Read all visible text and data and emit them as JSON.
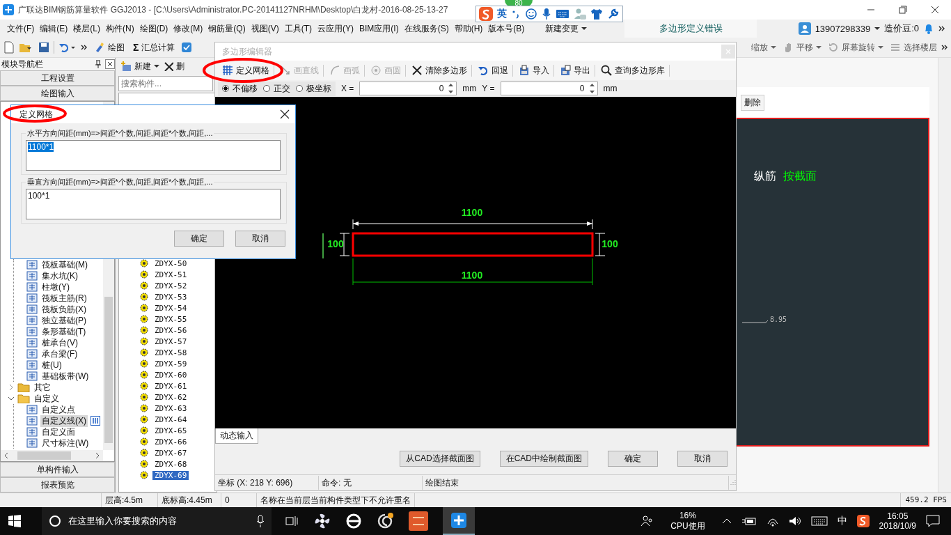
{
  "window": {
    "title": "广联达BIM钢筋算量软件 GGJ2013 - [C:\\Users\\Administrator.PC-20141127NRHM\\Desktop\\白龙村-2016-08-25-13-27"
  },
  "badge": "80",
  "ime_bar": {
    "label": "英"
  },
  "menu": [
    "文件(F)",
    "编辑(E)",
    "楼层(L)",
    "构件(N)",
    "绘图(D)",
    "修改(M)",
    "钢筋量(Q)",
    "视图(V)",
    "工具(T)",
    "云应用(Y)",
    "BIM应用(I)",
    "在线服务(S)",
    "帮助(H)",
    "版本号(B)"
  ],
  "menu_extra": {
    "new_change": "新建变更",
    "notice": "多边形定义错误",
    "account": "13907298339",
    "beans": "造价豆:0"
  },
  "toolbar": {
    "left": [
      {
        "kind": "draw",
        "label": "绘图"
      },
      {
        "kind": "sum",
        "symbol": "Σ",
        "label": "汇总计算"
      }
    ],
    "right": [
      {
        "kind": "zoom",
        "label": "缩放",
        "dropdown": true
      },
      {
        "kind": "pan",
        "label": "平移",
        "dropdown": true
      },
      {
        "kind": "rotate",
        "label": "屏幕旋转",
        "dropdown": true
      },
      {
        "kind": "floor",
        "label": "选择楼层",
        "dropdown": false
      }
    ]
  },
  "nav": {
    "title": "模块导航栏",
    "top_buttons": [
      "工程设置",
      "绘图输入"
    ],
    "tree": [
      {
        "expanded": true,
        "children": [
          {
            "label": "筏板基础(M)",
            "selected": false
          },
          {
            "label": "集水坑(K)",
            "selected": false
          },
          {
            "label": "柱墩(Y)",
            "selected": false
          },
          {
            "label": "筏板主筋(R)",
            "selected": false
          },
          {
            "label": "筏板负筋(X)",
            "selected": false
          },
          {
            "label": "独立基础(P)",
            "selected": false
          },
          {
            "label": "条形基础(T)",
            "selected": false
          },
          {
            "label": "桩承台(V)",
            "selected": false
          },
          {
            "label": "承台梁(F)",
            "selected": false
          },
          {
            "label": "桩(U)",
            "selected": false
          },
          {
            "label": "基础板带(W)",
            "selected": false
          }
        ]
      },
      {
        "label": "其它",
        "expanded": false
      },
      {
        "label": "自定义",
        "expanded": true,
        "children": [
          {
            "label": "自定义点",
            "selected": false
          },
          {
            "label": "自定义线(X)",
            "selected": true
          },
          {
            "label": "自定义面",
            "selected": false
          },
          {
            "label": "尺寸标注(W)",
            "selected": false
          }
        ]
      }
    ],
    "bottom_buttons": [
      "单构件输入",
      "报表预览"
    ]
  },
  "components": {
    "new": "新建",
    "delete": "删",
    "search_placeholder": "搜索构件...",
    "items": [
      {
        "label": "ZDYX-50",
        "selected": false
      },
      {
        "label": "ZDYX-51",
        "selected": false
      },
      {
        "label": "ZDYX-52",
        "selected": false
      },
      {
        "label": "ZDYX-53",
        "selected": false
      },
      {
        "label": "ZDYX-54",
        "selected": false
      },
      {
        "label": "ZDYX-55",
        "selected": false
      },
      {
        "label": "ZDYX-56",
        "selected": false
      },
      {
        "label": "ZDYX-57",
        "selected": false
      },
      {
        "label": "ZDYX-58",
        "selected": false
      },
      {
        "label": "ZDYX-59",
        "selected": false
      },
      {
        "label": "ZDYX-60",
        "selected": false
      },
      {
        "label": "ZDYX-61",
        "selected": false
      },
      {
        "label": "ZDYX-62",
        "selected": false
      },
      {
        "label": "ZDYX-63",
        "selected": false
      },
      {
        "label": "ZDYX-64",
        "selected": false
      },
      {
        "label": "ZDYX-65",
        "selected": false
      },
      {
        "label": "ZDYX-66",
        "selected": false
      },
      {
        "label": "ZDYX-67",
        "selected": false
      },
      {
        "label": "ZDYX-68",
        "selected": false
      },
      {
        "label": "ZDYX-69",
        "selected": true
      }
    ]
  },
  "editor": {
    "title": "多边形编辑器",
    "tools": [
      {
        "kind": "grid",
        "label": "定义网格",
        "disabled": false
      },
      {
        "kind": "line",
        "label": "画直线",
        "disabled": true
      },
      {
        "kind": "arc",
        "label": "画弧",
        "disabled": true
      },
      {
        "kind": "circle",
        "label": "画圆",
        "disabled": true
      },
      {
        "kind": "clear",
        "label": "清除多边形",
        "disabled": false
      },
      {
        "kind": "undo",
        "label": "回退",
        "disabled": false
      },
      {
        "kind": "import",
        "label": "导入",
        "disabled": false
      },
      {
        "kind": "export",
        "label": "导出",
        "disabled": false
      },
      {
        "kind": "search",
        "label": "查询多边形库",
        "disabled": false
      }
    ],
    "snap": [
      {
        "label": "不偏移",
        "selected": true
      },
      {
        "label": "正交",
        "selected": false
      },
      {
        "label": "极坐标",
        "selected": false
      }
    ],
    "x": {
      "label": "X =",
      "value": "0",
      "unit": "mm"
    },
    "y": {
      "label": "Y =",
      "value": "0",
      "unit": "mm"
    },
    "canvas": {
      "top_dim": "1100",
      "bottom_dim": "1100",
      "left_dim": "100",
      "right_dim": "100"
    },
    "dynamic_input": "动态输入",
    "buttons": [
      "从CAD选择截面图",
      "在CAD中绘制截面图",
      "确定",
      "取消"
    ],
    "status": [
      "坐标 (X: 218 Y: 696)",
      "命令: 无",
      "绘图结束"
    ]
  },
  "grid_dialog": {
    "title": "定义网格",
    "horizontal": {
      "label": "水平方向间距(mm)=>间距*个数,间距,间距*个数,间距,...",
      "value": "1100*1",
      "selected": true
    },
    "vertical": {
      "label": "垂直方向间距(mm)=>间距*个数,间距,间距*个数,间距,...",
      "value": "100*1",
      "selected": false
    },
    "buttons": [
      "确定",
      "取消"
    ]
  },
  "right_panel": {
    "delete": "删除",
    "labels": [
      {
        "text": "纵筋",
        "color": "#ffffff"
      },
      {
        "text": "按截面",
        "color": "#00ff00"
      }
    ],
    "elevation": "8.95"
  },
  "status_bar": {
    "cells": [
      "层高:4.5m",
      "底标高:4.45m",
      "0",
      "名称在当前层当前构件类型下不允许重名"
    ],
    "fps": "459.2 FPS"
  },
  "taskbar": {
    "search_placeholder": "在这里输入你要搜索的内容",
    "cpu": "16%",
    "cpu_label": "CPU使用",
    "ime": "中",
    "time": "16:05",
    "date": "2018/10/9"
  }
}
